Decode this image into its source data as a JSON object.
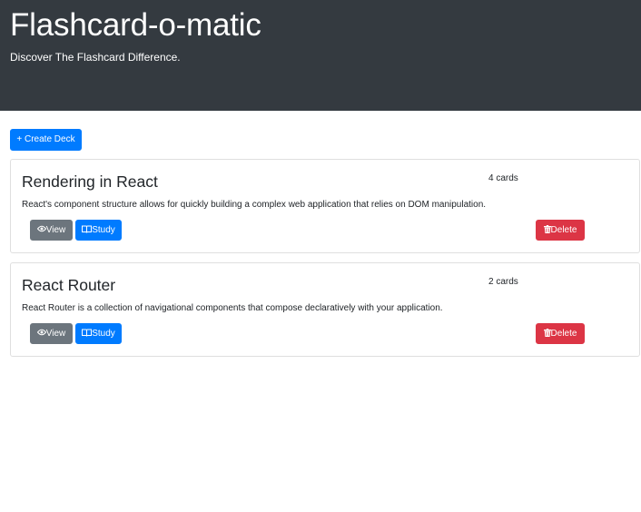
{
  "header": {
    "title": "Flashcard-o-matic",
    "subtitle": "Discover The Flashcard Difference."
  },
  "create_button_label": "+ Create Deck",
  "decks": [
    {
      "name": "Rendering in React",
      "card_count": "4 cards",
      "description": "React's component structure allows for quickly building a complex web application that relies on DOM manipulation.",
      "view_label": "View",
      "study_label": "Study",
      "delete_label": "Delete"
    },
    {
      "name": "React Router",
      "card_count": "2 cards",
      "description": "React Router is a collection of navigational components that compose declaratively with your application.",
      "view_label": "View",
      "study_label": "Study",
      "delete_label": "Delete"
    }
  ],
  "colors": {
    "header_bg": "#343a40",
    "primary": "#007bff",
    "secondary": "#6c757d",
    "danger": "#dc3545"
  },
  "icons": {
    "view": "eye-icon",
    "study": "book-icon",
    "delete": "trash-icon"
  }
}
